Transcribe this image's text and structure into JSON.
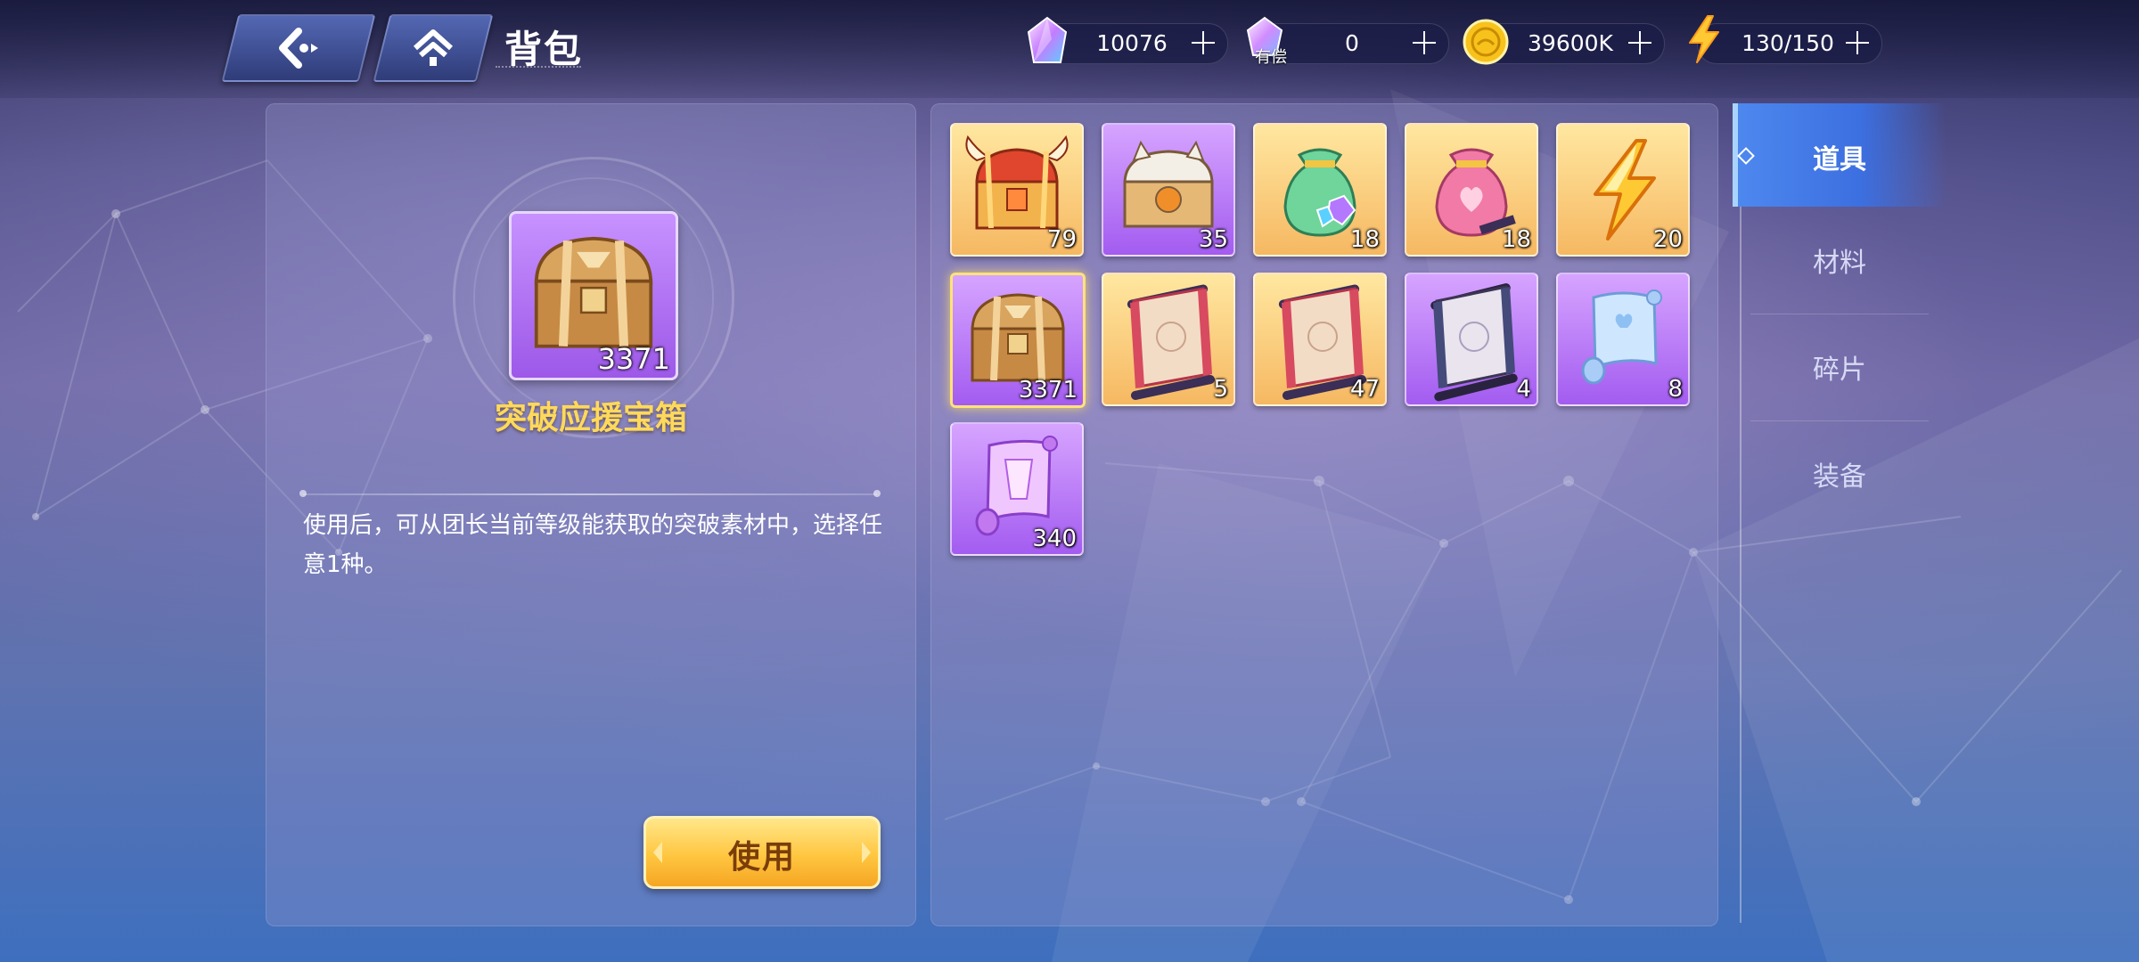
{
  "header": {
    "title": "背包",
    "back_icon": "back-arrow-icon",
    "home_icon": "home-icon"
  },
  "resources": [
    {
      "name": "gem",
      "icon": "crystal-icon",
      "value": "10076"
    },
    {
      "name": "paid-gem",
      "icon": "paid-crystal-icon",
      "value": "0",
      "label": "有偿"
    },
    {
      "name": "gold",
      "icon": "coin-icon",
      "value": "39600K"
    },
    {
      "name": "stamina",
      "icon": "lightning-icon",
      "value": "130/150"
    }
  ],
  "selected_item": {
    "name": "突破应援宝箱",
    "count": "3371",
    "description": "使用后，可从团长当前等级能获取的突破素材中，选择任意1种。",
    "use_label": "使用"
  },
  "items": [
    {
      "icon": "golden-horned-chest-icon",
      "count": "79",
      "rarity": "gold"
    },
    {
      "icon": "cat-chest-icon",
      "count": "35",
      "rarity": "purple"
    },
    {
      "icon": "green-gem-bag-icon",
      "count": "18",
      "rarity": "gold"
    },
    {
      "icon": "pink-heart-bag-icon",
      "count": "18",
      "rarity": "gold"
    },
    {
      "icon": "lightning-bolt-icon",
      "count": "20",
      "rarity": "gold"
    },
    {
      "icon": "wooden-chest-icon",
      "count": "3371",
      "rarity": "purple",
      "selected": true
    },
    {
      "icon": "red-scroll-icon",
      "count": "5",
      "rarity": "gold"
    },
    {
      "icon": "red-scroll-icon",
      "count": "47",
      "rarity": "gold"
    },
    {
      "icon": "dark-scroll-icon",
      "count": "4",
      "rarity": "purple"
    },
    {
      "icon": "blue-scroll-icon",
      "count": "8",
      "rarity": "purple"
    },
    {
      "icon": "purple-scroll-icon",
      "count": "340",
      "rarity": "purple"
    }
  ],
  "tabs": [
    {
      "label": "道具",
      "active": true
    },
    {
      "label": "材料",
      "active": false
    },
    {
      "label": "碎片",
      "active": false
    },
    {
      "label": "装备",
      "active": false
    }
  ],
  "colors": {
    "gold_card": "#f6b862",
    "purple_card": "#a35cf0",
    "accent_yellow": "#ffd95a",
    "tab_active": "#3c6fe0"
  }
}
